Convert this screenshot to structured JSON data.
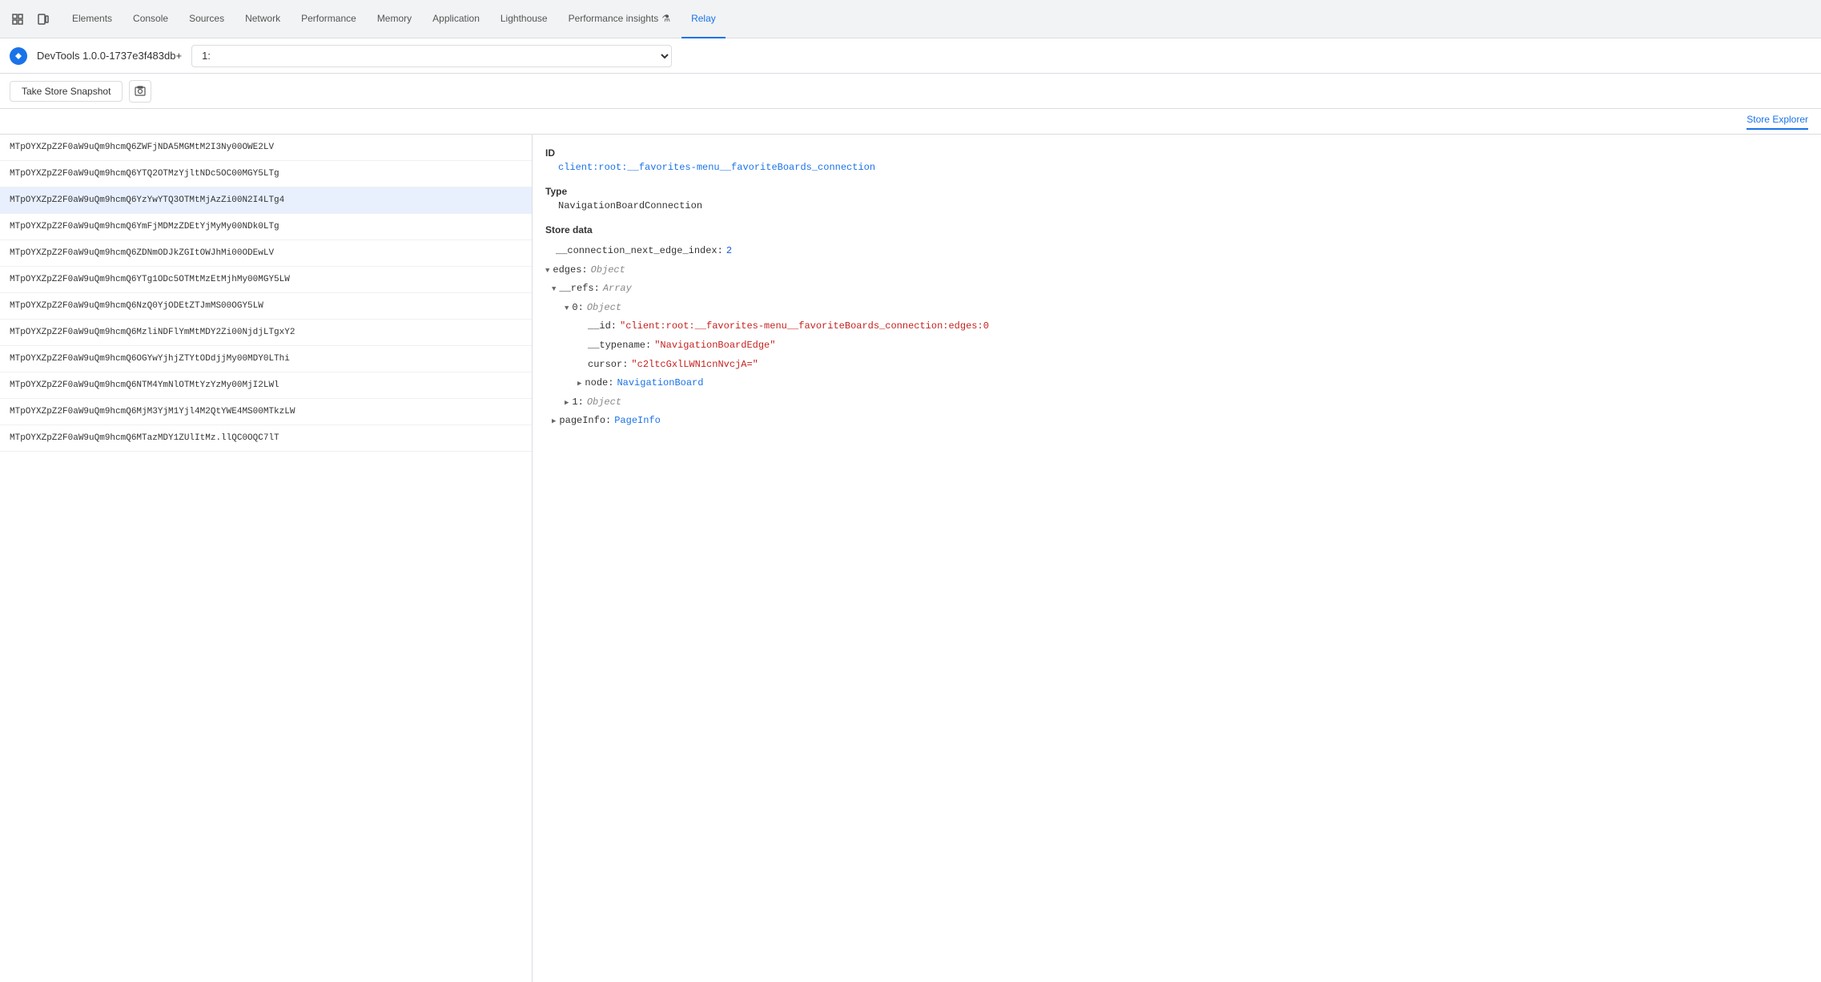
{
  "nav": {
    "tabs": [
      {
        "id": "elements",
        "label": "Elements",
        "active": false
      },
      {
        "id": "console",
        "label": "Console",
        "active": false
      },
      {
        "id": "sources",
        "label": "Sources",
        "active": false
      },
      {
        "id": "network",
        "label": "Network",
        "active": false
      },
      {
        "id": "performance",
        "label": "Performance",
        "active": false
      },
      {
        "id": "memory",
        "label": "Memory",
        "active": false
      },
      {
        "id": "application",
        "label": "Application",
        "active": false
      },
      {
        "id": "lighthouse",
        "label": "Lighthouse",
        "active": false
      },
      {
        "id": "performance-insights",
        "label": "Performance insights",
        "active": false
      },
      {
        "id": "relay",
        "label": "Relay",
        "active": true
      }
    ]
  },
  "toolbar": {
    "devtools_label": "DevTools 1.0.0-1737e3f483db+",
    "store_select_value": "1:",
    "store_select_options": [
      "1:"
    ]
  },
  "action_bar": {
    "snapshot_btn_label": "Take Store Snapshot"
  },
  "store_explorer_bar": {
    "label": "Store Explorer"
  },
  "list": {
    "items": [
      "MTpOYXZpZ2F0aW9uQm9hcmQ6ZWFjNDA5MGMtM2I3Ny00OWE2LV",
      "MTpOYXZpZ2F0aW9uQm9hcmQ6YTQ2OTMzYjltNDc5OC00MGY5LTg",
      "MTpOYXZpZ2F0aW9uQm9hcmQ6YzYwYTQ3OTMtMjAzZi00N2I4LTg4",
      "MTpOYXZpZ2F0aW9uQm9hcmQ6YmFjMDMzZDEtYjMyMy00NDk0LTg",
      "MTpOYXZpZ2F0aW9uQm9hcmQ6ZDNmODJkZGItOWJhMi00ODEwLV",
      "MTpOYXZpZ2F0aW9uQm9hcmQ6YTg1ODc5OTMtMzEtMjhMy00MGY5LW",
      "MTpOYXZpZ2F0aW9uQm9hcmQ6NzQ0YjODEtZTJmMS00OGY5LW",
      "MTpOYXZpZ2F0aW9uQm9hcmQ6MzliNDFlYmMtMDY2Zi00NjdjLTgxY2",
      "MTpOYXZpZ2F0aW9uQm9hcmQ6OGYwYjhjZTYtODdjjMy00MDY0LThi",
      "MTpOYXZpZ2F0aW9uQm9hcmQ6NTM4YmNlOTMtYzYzMy00MjI2LWl",
      "MTpOYXZpZ2F0aW9uQm9hcmQ6MjM3YjM1Yjl4M2QtYWE4MS00MTkzLW",
      "MTpOYXZpZ2F0aW9uQm9hcmQ6MTazMDY1ZUlItMz.llQC0OQC7lT"
    ]
  },
  "detail": {
    "id_label": "ID",
    "id_value": "client:root:__favorites-menu__favoriteBoards_connection",
    "type_label": "Type",
    "type_value": "NavigationBoardConnection",
    "store_data_label": "Store data",
    "fields": {
      "connection_next_edge_index_key": "__connection_next_edge_index:",
      "connection_next_edge_index_value": "2",
      "edges_key": "edges:",
      "edges_type": "Object",
      "refs_key": "__refs:",
      "refs_type": "Array",
      "item0_key": "0:",
      "item0_type": "Object",
      "id_key": "__id:",
      "id_value": "\"client:root:__favorites-menu__favoriteBoards_connection:edges:0",
      "typename_key": "__typename:",
      "typename_value": "\"NavigationBoardEdge\"",
      "cursor_key": "cursor:",
      "cursor_value": "\"c2ltcGxlLWN1cnNvcjA=\"",
      "node_key": "node:",
      "node_value": "NavigationBoard",
      "item1_key": "1:",
      "item1_type": "Object",
      "pageinfo_key": "pageInfo:",
      "pageinfo_value": "PageInfo"
    }
  }
}
